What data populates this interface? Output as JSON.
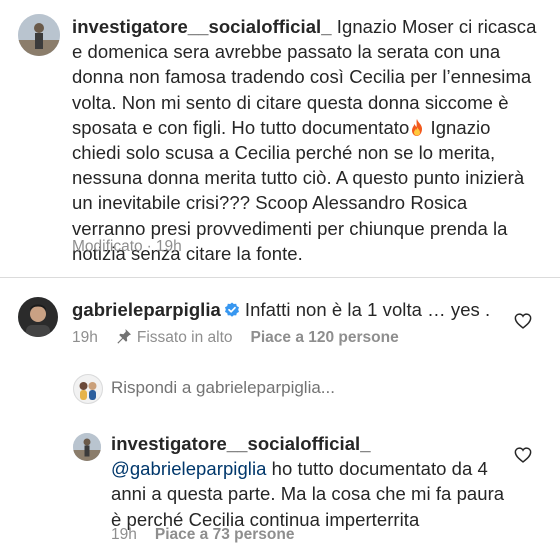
{
  "comment1": {
    "username": "investigatore__socialofficial_",
    "text_part1": "Ignazio Moser ci ricasca e domenica sera avrebbe passato la serata con una donna non famosa tradendo così Cecilia per l’ennesima volta. Non mi sento di citare questa donna siccome è sposata e con figli. Ho tutto documentato",
    "fire_emoji_name": "fire-emoji",
    "text_part2": "Ignazio chiedi solo scusa a Cecilia perché non se lo merita, nessuna donna merita tutto ciò. A questo punto inizierà un inevitabile crisi??? Scoop Alessandro Rosica verranno presi provvedimenti per chiunque prenda la notizia senza citare la fonte.",
    "edited": "Modificato",
    "separator": "·",
    "time": "19h"
  },
  "comment2": {
    "username": "gabrieleparpiglia",
    "text": "Infatti non è la 1 volta … yes .",
    "time": "19h",
    "pinned_label": "Fissato in alto",
    "likes": "Piace a 120 persone"
  },
  "reply_prompt": {
    "text": "Rispondi a gabrieleparpiglia..."
  },
  "reply": {
    "username": "investigatore__socialofficial_",
    "mention": "@gabrieleparpiglia",
    "text": "ho tutto documentato da 4 anni a questa parte. Ma la cosa che mi fa paura è perché Cecilia continua imperterrita",
    "time": "19h",
    "likes": "Piace a 73 persone"
  },
  "colors": {
    "text": "#262626",
    "secondary": "#8e8e8e",
    "mention": "#00376b",
    "verified": "#3897f0",
    "divider": "#dbdbdb"
  },
  "icons": [
    "heart-outline-icon",
    "verified-badge-icon",
    "pin-icon"
  ]
}
